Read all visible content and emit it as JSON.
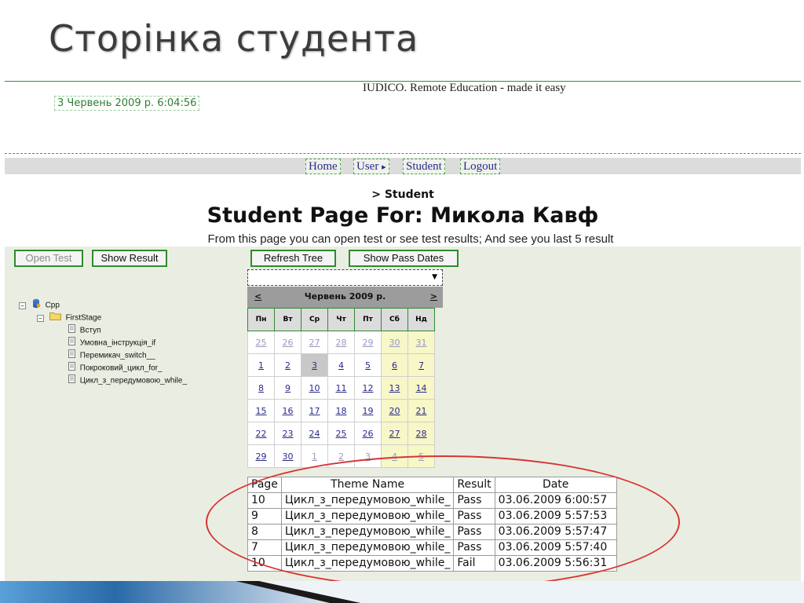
{
  "slide": {
    "title": "Сторінка студента"
  },
  "site": {
    "tagline": "IUDICO. Remote Education - made it easy",
    "clock": "3 Червень 2009 р. 6:04:56"
  },
  "nav": {
    "home": "Home",
    "user": "User",
    "user_arrow": "▸",
    "student": "Student",
    "logout": "Logout"
  },
  "page": {
    "breadcrumb": "> Student",
    "heading": "Student Page For: Микола Кавф",
    "description": "From this page you can open test or see test results; And see you last 5 result"
  },
  "buttons": {
    "open_test": "Open Test",
    "show_result": "Show Result",
    "refresh_tree": "Refresh Tree",
    "show_pass_dates": "Show Pass Dates"
  },
  "tree": {
    "root_toggle": "−",
    "root": "Cpp",
    "child_toggle": "−",
    "child": "FirstStage",
    "items": [
      "Вступ",
      "Умовна_інструкція_if",
      "Перемикач_switch__",
      "Покроковий_цикл_for_",
      "Цикл_з_передумовою_while_"
    ]
  },
  "select": {
    "value": "",
    "arrow": "▼"
  },
  "calendar": {
    "prev": "<",
    "next": ">",
    "title": "Червень 2009 р.",
    "weekdays": [
      "Пн",
      "Вт",
      "Ср",
      "Чт",
      "Пт",
      "Сб",
      "Нд"
    ],
    "weeks": [
      [
        "25",
        "26",
        "27",
        "28",
        "29",
        "30",
        "31"
      ],
      [
        "1",
        "2",
        "3",
        "4",
        "5",
        "6",
        "7"
      ],
      [
        "8",
        "9",
        "10",
        "11",
        "12",
        "13",
        "14"
      ],
      [
        "15",
        "16",
        "17",
        "18",
        "19",
        "20",
        "21"
      ],
      [
        "22",
        "23",
        "24",
        "25",
        "26",
        "27",
        "28"
      ],
      [
        "29",
        "30",
        "1",
        "2",
        "3",
        "4",
        "5"
      ]
    ],
    "selected_day": "3"
  },
  "results": {
    "headers": [
      "Page",
      "Theme Name",
      "Result",
      "Date"
    ],
    "rows": [
      [
        "10",
        "Цикл_з_передумовою_while_",
        "Pass",
        "03.06.2009 6:00:57"
      ],
      [
        "9",
        "Цикл_з_передумовою_while_",
        "Pass",
        "03.06.2009 5:57:53"
      ],
      [
        "8",
        "Цикл_з_передумовою_while_",
        "Pass",
        "03.06.2009 5:57:47"
      ],
      [
        "7",
        "Цикл_з_передумовою_while_",
        "Pass",
        "03.06.2009 5:57:40"
      ],
      [
        "10",
        "Цикл_з_передумовою_while_",
        "Fail",
        "03.06.2009 5:56:31"
      ]
    ]
  },
  "colors": {
    "accent_green": "#2e8b2e",
    "link_blue": "#2a2a8a",
    "highlight_red": "#d83434",
    "content_bg": "#eaeee2"
  },
  "icons": {
    "root": "database-user-icon",
    "folder": "folder-icon",
    "doc": "document-icon"
  }
}
